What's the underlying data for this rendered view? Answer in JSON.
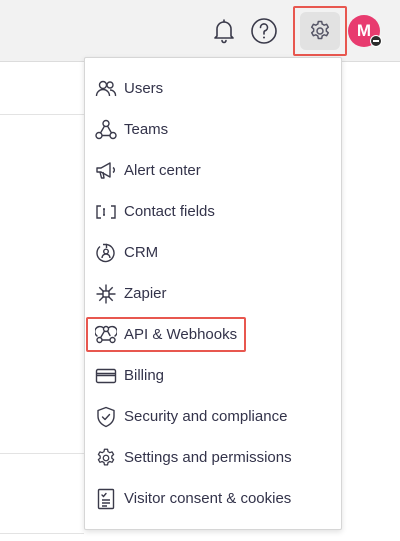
{
  "header": {
    "avatar_initial": "M",
    "icons": [
      "bell-icon",
      "help-icon",
      "gear-icon"
    ]
  },
  "menu": {
    "items": [
      {
        "label": "Users",
        "icon": "users-icon"
      },
      {
        "label": "Teams",
        "icon": "teams-icon"
      },
      {
        "label": "Alert center",
        "icon": "megaphone-icon"
      },
      {
        "label": "Contact fields",
        "icon": "contact-fields-icon"
      },
      {
        "label": "CRM",
        "icon": "crm-icon"
      },
      {
        "label": "Zapier",
        "icon": "zapier-icon"
      },
      {
        "label": "API & Webhooks",
        "icon": "webhooks-icon"
      },
      {
        "label": "Billing",
        "icon": "card-icon"
      },
      {
        "label": "Security and compliance",
        "icon": "shield-icon"
      },
      {
        "label": "Settings and permissions",
        "icon": "gear-icon"
      },
      {
        "label": "Visitor consent & cookies",
        "icon": "consent-doc-icon"
      }
    ]
  },
  "colors": {
    "highlight": "#e8574f",
    "avatar": "#e83b6f",
    "text": "#33334a"
  }
}
